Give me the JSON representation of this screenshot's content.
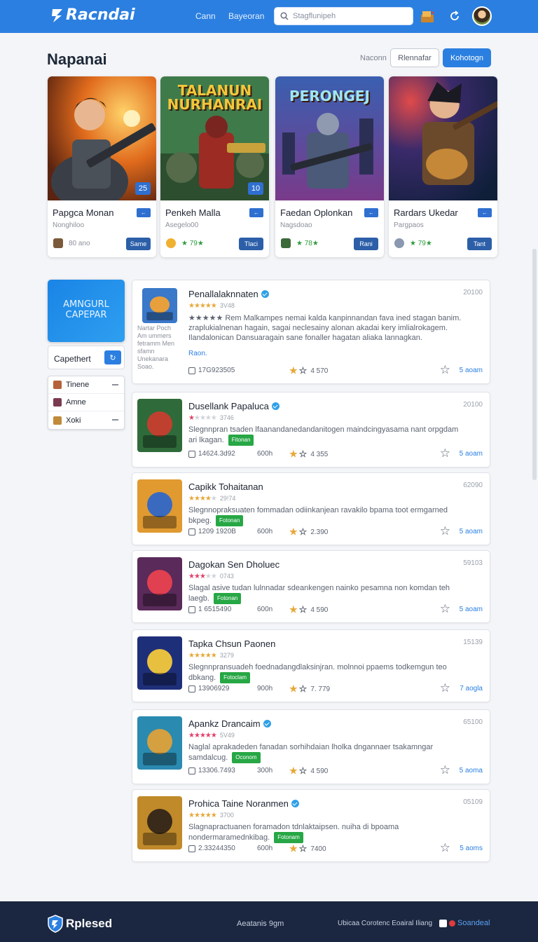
{
  "header": {
    "logo": "Racndai",
    "nav": [
      "Cann",
      "Bayeoran"
    ],
    "search_placeholder": "Stagflunipeh"
  },
  "page": {
    "title": "Napanai",
    "filter_label": "Naconn",
    "btn_secondary": "Rlennafar",
    "btn_primary": "Kohotogn"
  },
  "featured": [
    {
      "banner": "",
      "badge": "25",
      "title": "Papgca Monan",
      "tag": "←",
      "sub": "Nonghiloo",
      "meta": "80 ano",
      "button": "Same"
    },
    {
      "banner": "TALANUN NURHANRAI",
      "badge": "10",
      "title": "Penkeh Malla",
      "tag": "←",
      "sub": "Asegelo00",
      "meta": "★ 79★",
      "button": "Tlaci"
    },
    {
      "banner": "PERONGEJ",
      "badge": "",
      "title": "Faedan Oplonkan",
      "tag": "←",
      "sub": "Nagsdoao",
      "meta": "★ 78★",
      "button": "Rani"
    },
    {
      "banner": "",
      "badge": "",
      "title": "Rardars Ukedar",
      "tag": "←",
      "sub": "Pargpaos",
      "meta": "★ 79★",
      "button": "Tant"
    }
  ],
  "sidebar": {
    "promo": "AMNGURL CAPEPAR",
    "promo_note": "Nartar Poch Am ummers fetramm Men sfamn Unekanara Soao.",
    "box_label": "Capethert",
    "items": [
      {
        "label": "Tinene"
      },
      {
        "label": "Amne"
      },
      {
        "label": "Xoki"
      }
    ]
  },
  "games": [
    {
      "title": "Penallalaknnaten",
      "verified": true,
      "rating": 5,
      "rating_text": "3V48",
      "date": "20100",
      "desc": "★★★★★ Rem Malkampes nemai kalda kanpinnandan fava ined stagan banim. zraplukialnenan hagain, sagai neclesainy alonan akadai kery imlialrokagem. Ilandalonican Dansuaragain sane fonaller hagatan aliaka lannagkan.",
      "link": "Raon.",
      "chip": "",
      "downloads": "17G923505",
      "size": "",
      "score": "4 570",
      "action": "5 aoam"
    },
    {
      "title": "Dusellank Papaluca",
      "verified": true,
      "rating": 1,
      "rating_text": "3746",
      "date": "20100",
      "desc": "Slegnnpran tsaden lfaanandanedandanitogen maindcingyasama nant orpgdam ari lkagan.",
      "link": "",
      "chip": "Fitonan",
      "downloads": "14624.3d92",
      "size": "600h",
      "score": "4 355",
      "action": "5 aoam"
    },
    {
      "title": "Capikk Tohaitanan",
      "verified": false,
      "rating": 4,
      "rating_text": "29!74",
      "date": "62090",
      "desc": "Slegnnopraksuaten fommadan odiinkanjean ravakilo bpama toot ermgarned bkpeg.",
      "link": "",
      "chip": "Fotonan",
      "downloads": "1209 1920B",
      "size": "600h",
      "score": "2.390",
      "action": "5 aoam"
    },
    {
      "title": "Dagokan Sen Dholuec",
      "verified": false,
      "rating": 3,
      "rating_text": "0743",
      "date": "59103",
      "desc": "Slagal asive tudan lulnnadar sdeankengen nainko pesamna non komdan teh laegb.",
      "link": "",
      "chip": "Fotonan",
      "downloads": "1 6515490",
      "size": "600n",
      "score": "4 590",
      "action": "5 aoam"
    },
    {
      "title": "Tapka Chsun Paonen",
      "verified": false,
      "rating": 5,
      "rating_text": "3279",
      "date": "15139",
      "desc": "Slegnnpransuadeh foednadangdlaksinjran. molnnoi ppaems todkemgun teo dbkang.",
      "link": "",
      "chip": "Fotoclam",
      "downloads": "13906929",
      "size": "900h",
      "score": "7. 779",
      "action": "7 aogla"
    },
    {
      "title": "Apankz Drancaim",
      "verified": true,
      "rating": 5,
      "rating_text": "5V49",
      "date": "65100",
      "desc": "Naglal aprakadeden fanadan sorhihdaian lholka dngannaer tsakamngar samdalcug.",
      "link": "",
      "chip": "Oconom",
      "downloads": "13306.7493",
      "size": "300h",
      "score": "4 590",
      "action": "5 aoma"
    },
    {
      "title": "Prohica Taine Noranmen",
      "verified": true,
      "rating": 5,
      "rating_text": "3700",
      "date": "05109",
      "desc": "Slagnapractuanen foramadon tdnlaktaipsen. nuiha di bpoama nondermaramednkibag.",
      "link": "",
      "chip": "Fotonam",
      "downloads": "2.33244350",
      "size": "600h",
      "score": "7400",
      "action": "5 aoms"
    }
  ],
  "footer": {
    "logo": "Rplesed",
    "center": "Aeatanis 9gm",
    "right": "Ubicaa Corotenc Eoairal Iliang",
    "link": "Soandeal"
  },
  "colors": {
    "accent": "#2b7fe0",
    "header": "#2b7fe0",
    "footer": "#1b2740",
    "chip": "#27a745"
  }
}
